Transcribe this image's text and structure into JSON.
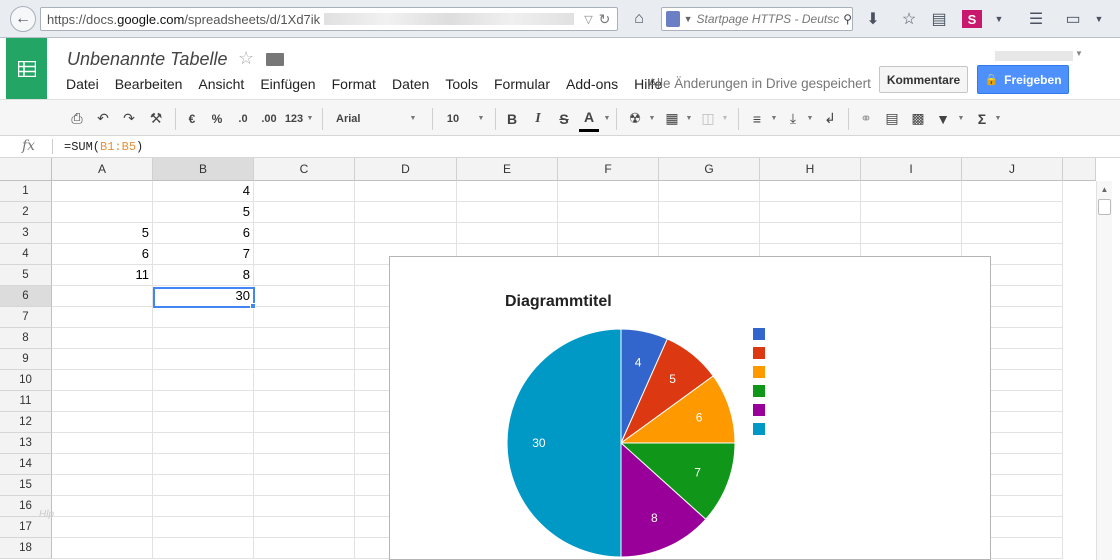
{
  "browser": {
    "url_prefix": "https://docs.",
    "url_domain": "google.com",
    "url_path": "/spreadsheets/d/1Xd7ik",
    "search_placeholder": "Startpage HTTPS - Deutsc"
  },
  "app": {
    "title": "Unbenannte Tabelle",
    "menu": [
      "Datei",
      "Bearbeiten",
      "Ansicht",
      "Einfügen",
      "Format",
      "Daten",
      "Tools",
      "Formular",
      "Add-ons",
      "Hilfe"
    ],
    "saved_status": "Alle Änderungen in Drive gespeichert",
    "comments_label": "Kommentare",
    "share_label": "Freigeben"
  },
  "toolbar": {
    "currency": "€",
    "percent": "%",
    "dec_less": ".0",
    "dec_more": ".00",
    "more_formats": "123",
    "font": "Arial",
    "font_size": "10",
    "bold": "B",
    "italic": "I",
    "strike": "S",
    "text_color": "A",
    "sum": "Σ"
  },
  "formula_bar": {
    "fx": "fx",
    "text_before": "=SUM(",
    "ref": "B1:B5",
    "text_after": ")"
  },
  "grid": {
    "columns": [
      "A",
      "B",
      "C",
      "D",
      "E",
      "F",
      "G",
      "H",
      "I",
      "J"
    ],
    "rows": [
      "1",
      "2",
      "3",
      "4",
      "5",
      "6",
      "7",
      "8",
      "9",
      "10",
      "11",
      "12",
      "13",
      "14",
      "15",
      "16",
      "17",
      "18"
    ],
    "cells": {
      "A3": "5",
      "A4": "6",
      "A5": "11",
      "B1": "4",
      "B2": "5",
      "B3": "6",
      "B4": "7",
      "B5": "8",
      "B6": "30"
    },
    "selected_cell": "B6"
  },
  "chart_data": {
    "type": "pie",
    "title": "Diagrammtitel",
    "values": [
      4,
      5,
      6,
      7,
      8,
      30
    ],
    "slice_labels": [
      "4",
      "5",
      "6",
      "7",
      "8",
      "30"
    ],
    "colors": [
      "#3366cc",
      "#dc3912",
      "#ff9900",
      "#109618",
      "#990099",
      "#0099c6"
    ],
    "legend_position": "right"
  },
  "watermark": "Hlp"
}
